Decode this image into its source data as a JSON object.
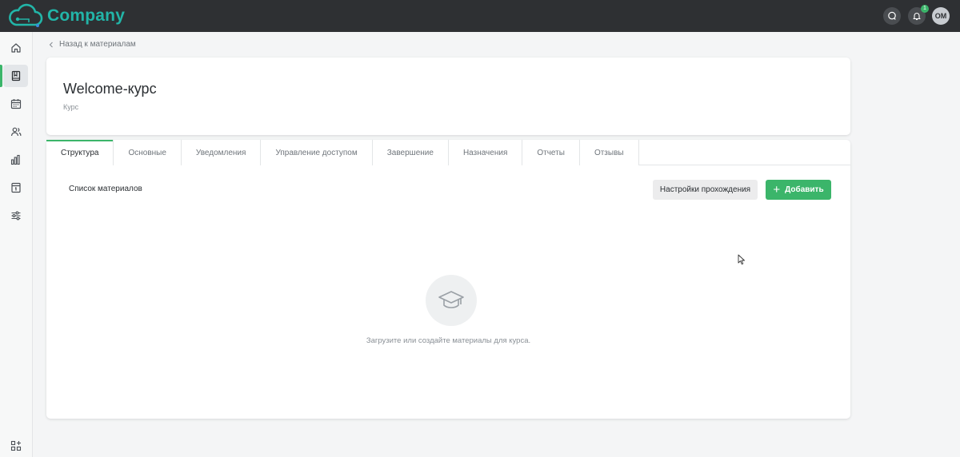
{
  "app": {
    "brand": "Company",
    "notifications_count": "1",
    "user_initials": "OM"
  },
  "breadcrumb": {
    "back_label": "Назад к материалам"
  },
  "header": {
    "title": "Welcome-курс",
    "subtitle": "Курс"
  },
  "tabs": [
    {
      "label": "Структура",
      "active": true
    },
    {
      "label": "Основные"
    },
    {
      "label": "Уведомления"
    },
    {
      "label": "Управление доступом"
    },
    {
      "label": "Завершение"
    },
    {
      "label": "Назначения"
    },
    {
      "label": "Отчеты"
    },
    {
      "label": "Отзывы"
    }
  ],
  "content": {
    "list_title": "Список материалов",
    "settings_button": "Настройки прохождения",
    "add_button": "Добавить",
    "empty_text": "Загрузите или создайте материалы для курса."
  },
  "sidebar": {
    "items": [
      {
        "icon": "home-icon"
      },
      {
        "icon": "book-icon",
        "active": true
      },
      {
        "icon": "calendar-icon"
      },
      {
        "icon": "users-icon"
      },
      {
        "icon": "bar-chart-icon"
      },
      {
        "icon": "page-icon"
      },
      {
        "icon": "sliders-icon"
      }
    ],
    "bottom_icon": "apps-add-icon"
  },
  "colors": {
    "topbar": "#2e3033",
    "brand": "#22b5a8",
    "accent": "#3bb56a"
  }
}
